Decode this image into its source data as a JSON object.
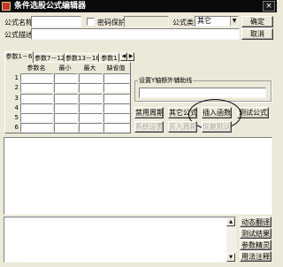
{
  "window": {
    "title": "条件选股公式编辑器",
    "close_label": "×"
  },
  "header": {
    "name_label": "公式名称",
    "name_value": "",
    "password_label": "密码保护",
    "password_checked": false,
    "password_value": "",
    "type_label": "公式类型",
    "type_value": "其它",
    "confirm_button": "确定",
    "cancel_button": "取消",
    "desc_label": "公式描述",
    "desc_value": ""
  },
  "tabs": [
    {
      "label": "参数1－6"
    },
    {
      "label": "参数7－12"
    },
    {
      "label": "参数13－18"
    },
    {
      "label": "参数1"
    }
  ],
  "tab_scroll": {
    "left": "◀",
    "right": "▶"
  },
  "param_table": {
    "headers": [
      "参数名",
      "最小",
      "最大",
      "缺省值"
    ],
    "rows": [
      {
        "num": "1",
        "name": "",
        "min": "",
        "max": "",
        "default": ""
      },
      {
        "num": "2",
        "name": "",
        "min": "",
        "max": "",
        "default": ""
      },
      {
        "num": "3",
        "name": "",
        "min": "",
        "max": "",
        "default": ""
      },
      {
        "num": "4",
        "name": "",
        "min": "",
        "max": "",
        "default": ""
      },
      {
        "num": "5",
        "name": "",
        "min": "",
        "max": "",
        "default": ""
      },
      {
        "num": "6",
        "name": "",
        "min": "",
        "max": "",
        "default": ""
      }
    ]
  },
  "settings": {
    "group_label": "设置Y轴额外辅助线",
    "value": ""
  },
  "actions": {
    "disable_period": "禁用周期",
    "other_formula": "其它公式",
    "insert_function": "插入函数",
    "test_formula": "测试公式",
    "system_settings": "系统设置",
    "import_period": "买入周期",
    "restore_default": "恢复默认"
  },
  "bottom_buttons": {
    "dynamic_translate": "动态翻译",
    "test_result": "测试结果",
    "param_wizard": "参数精灵",
    "usage_notes": "用法注释"
  },
  "scrollbar": {
    "up": "▲",
    "down": "▼"
  }
}
